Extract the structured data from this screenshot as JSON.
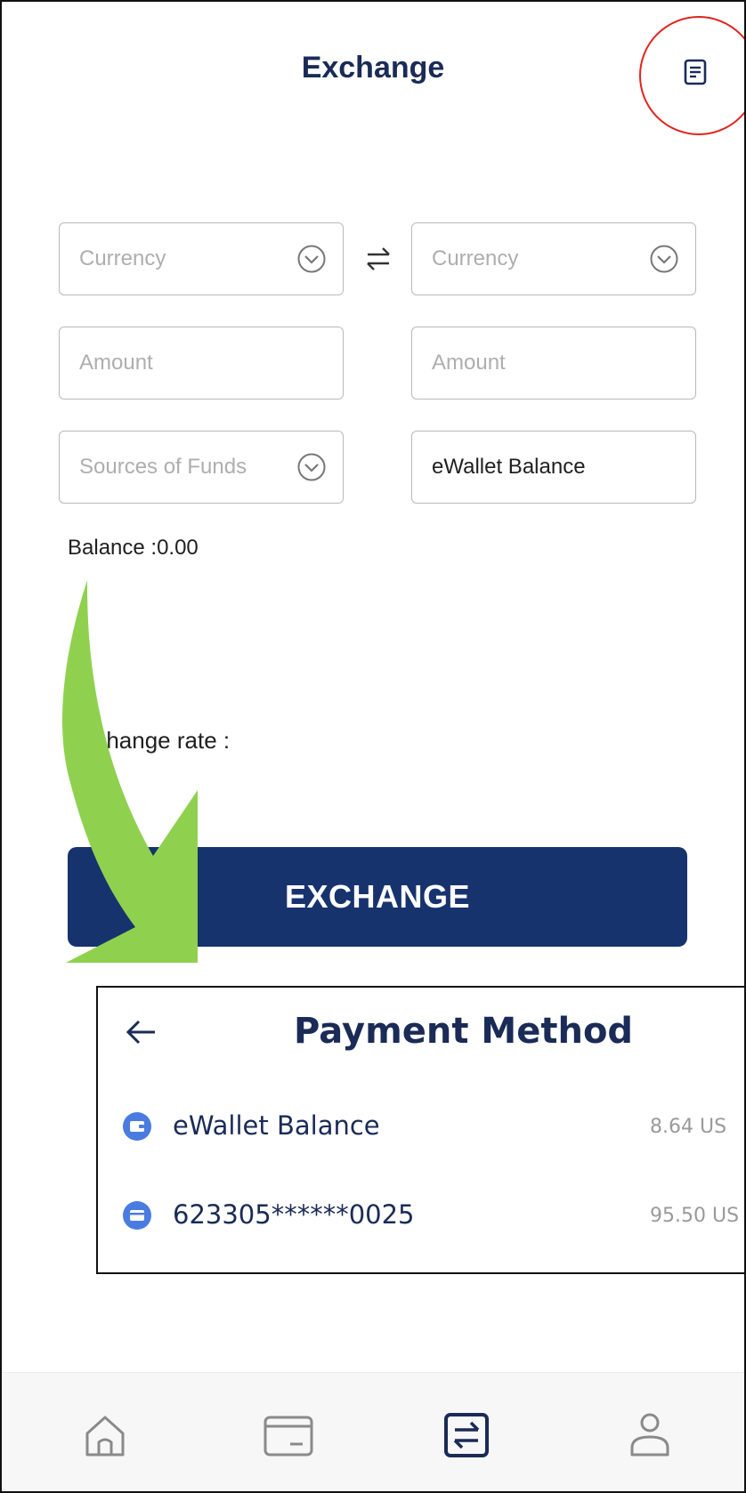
{
  "header": {
    "title": "Exchange"
  },
  "form": {
    "from_currency_placeholder": "Currency",
    "to_currency_placeholder": "Currency",
    "from_amount_placeholder": "Amount",
    "to_amount_placeholder": "Amount",
    "source_of_funds_placeholder": "Sources of Funds",
    "destination_value": "eWallet Balance"
  },
  "balance_text": "Balance :0.00",
  "exchange_rate_label": "Exchange rate :",
  "exchange_button_label": "EXCHANGE",
  "payment_method": {
    "title": "Payment Method",
    "items": [
      {
        "name": "eWallet Balance",
        "amount": "8.64 US"
      },
      {
        "name": "623305******0025",
        "amount": "95.50 US"
      }
    ]
  },
  "bottom_nav": {
    "items": [
      {
        "icon": "home-icon"
      },
      {
        "icon": "wallet-icon"
      },
      {
        "icon": "exchange-icon",
        "active": true
      },
      {
        "icon": "profile-icon"
      }
    ]
  },
  "colors": {
    "primary": "#17336e",
    "title": "#1a2b57",
    "highlight_circle": "#e0241e",
    "annotation_arrow": "#8fd14f",
    "payment_dot": "#4a7be0"
  }
}
